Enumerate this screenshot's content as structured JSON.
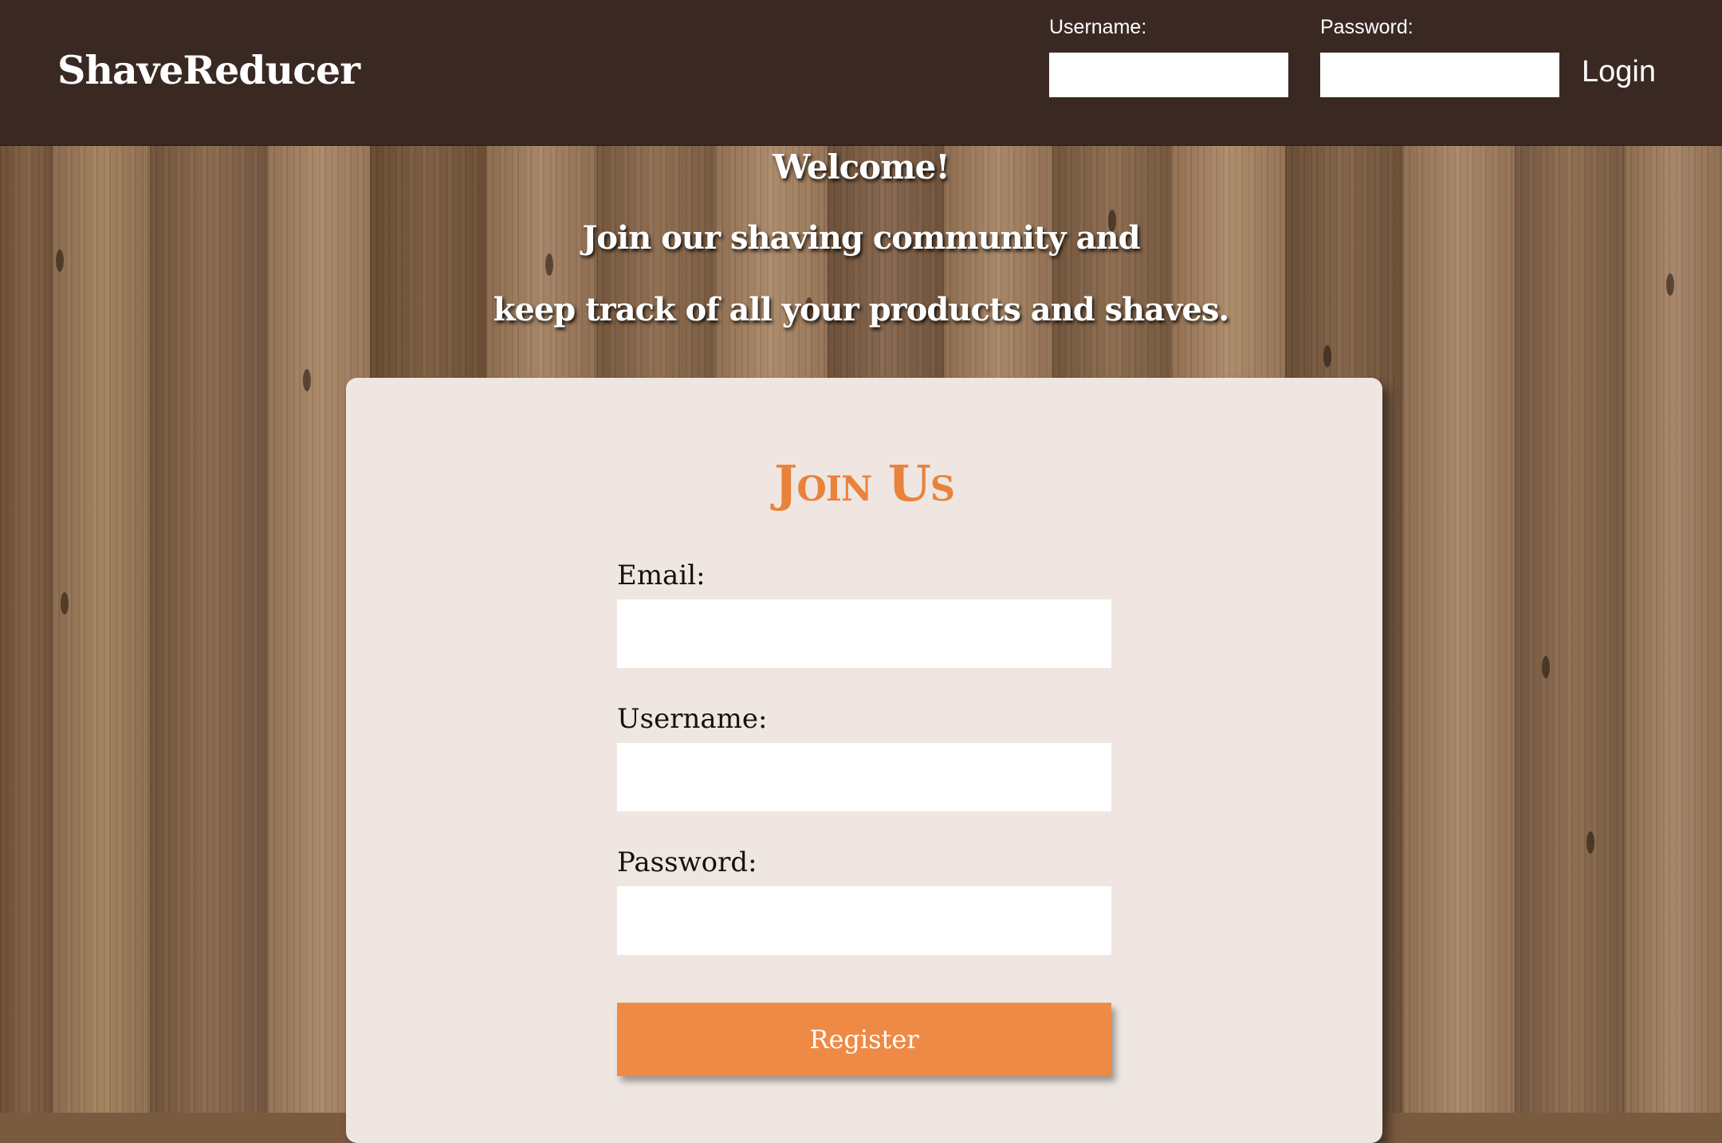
{
  "header": {
    "brand": "ShaveReducer",
    "username_label": "Username:",
    "password_label": "Password:",
    "username_value": "",
    "password_value": "",
    "login_label": "Login"
  },
  "hero": {
    "welcome": "Welcome!",
    "line1": "Join our shaving community and",
    "line2": "keep track of all your products and shaves."
  },
  "signup": {
    "title": "Join Us",
    "email_label": "Email:",
    "email_value": "",
    "username_label": "Username:",
    "username_value": "",
    "password_label": "Password:",
    "password_value": "",
    "register_label": "Register"
  },
  "colors": {
    "header_bg": "#3a2923",
    "card_bg": "#efe6e1",
    "accent": "#ee8a45",
    "title": "#e9823b"
  }
}
